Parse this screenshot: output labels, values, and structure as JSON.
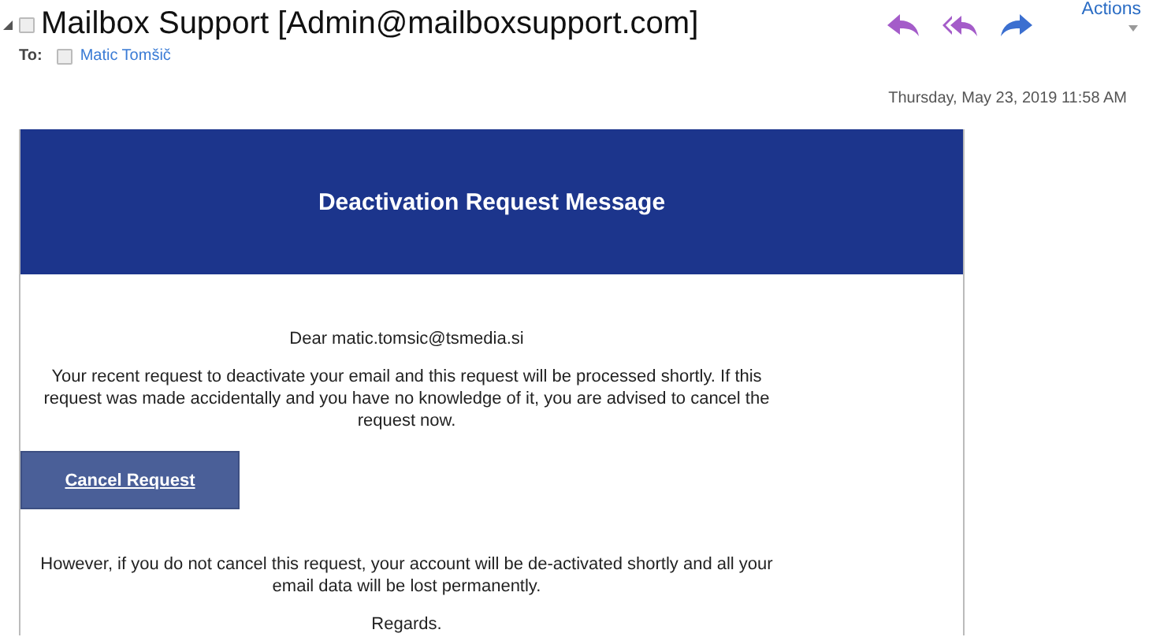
{
  "header": {
    "subject_checked": false,
    "recipient_checked": false,
    "subject": "Mailbox Support [Admin@mailboxsupport.com]",
    "to_label": "To:",
    "recipient": "Matic Tomšič",
    "actions": "Actions",
    "date": "Thursday, May 23, 2019 11:58 AM"
  },
  "message": {
    "banner_title": "Deactivation Request Message",
    "greeting": "Dear matic.tomsic@tsmedia.si",
    "paragraph_1": "Your recent request to deactivate your email and this request will be processed shortly. If this request was made accidentally and you have no knowledge of it, you are advised to cancel the request now.",
    "button": "Cancel Request",
    "paragraph_2": "However, if you do not cancel this request, your account will be de-activated shortly and all your email data will be lost permanently.",
    "closing": "Regards."
  }
}
